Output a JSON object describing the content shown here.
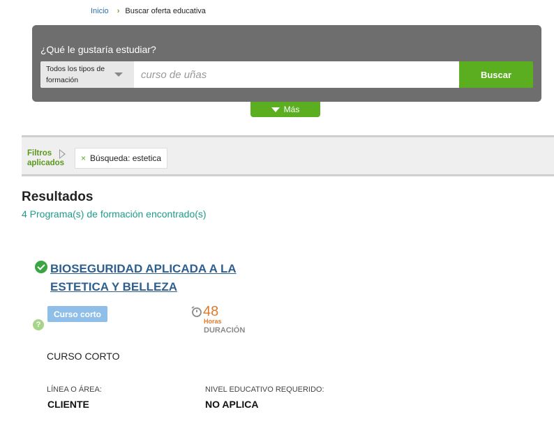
{
  "breadcrumb": {
    "home": "Inicio",
    "current": "Buscar oferta educativa"
  },
  "search": {
    "question": "¿Qué le gustaría estudiar?",
    "type_select": "Todos los tipos de formación",
    "placeholder": "curso de uñas",
    "button": "Buscar",
    "more": "Más"
  },
  "filters": {
    "label": "Filtros aplicados",
    "chip_remove": "×",
    "chip": "Búsqueda: estetica"
  },
  "results": {
    "title": "Resultados",
    "count": "4 Programa(s) de formación encontrado(s)"
  },
  "program": {
    "title": "BIOSEGURIDAD APLICADA A LA ESTETICA Y BELLEZA",
    "badge": "Curso corto",
    "help": "?",
    "duration_value": "48",
    "duration_unit": "Horas",
    "duration_label": "DURACIÓN",
    "type": "CURSO CORTO",
    "area_label": "LÍNEA O ÁREA:",
    "area_value": "CLIENTE",
    "level_label": "NIVEL EDUCATIVO REQUERIDO:",
    "level_value": "NO APLICA"
  },
  "colors": {
    "accent_green": "#5aae1f",
    "panel_gray": "#6e6e6e",
    "title_blue": "#2f5f8f",
    "count_teal": "#1e9b8a",
    "duration_orange": "#e07a2b"
  },
  "icons": {
    "breadcrumb_separator": "chevron-right-icon",
    "more": "triangle-down-icon",
    "filters": "triangle-right-icon",
    "verified": "check-circle-icon",
    "help": "help-circle-icon",
    "duration": "timer-icon"
  }
}
